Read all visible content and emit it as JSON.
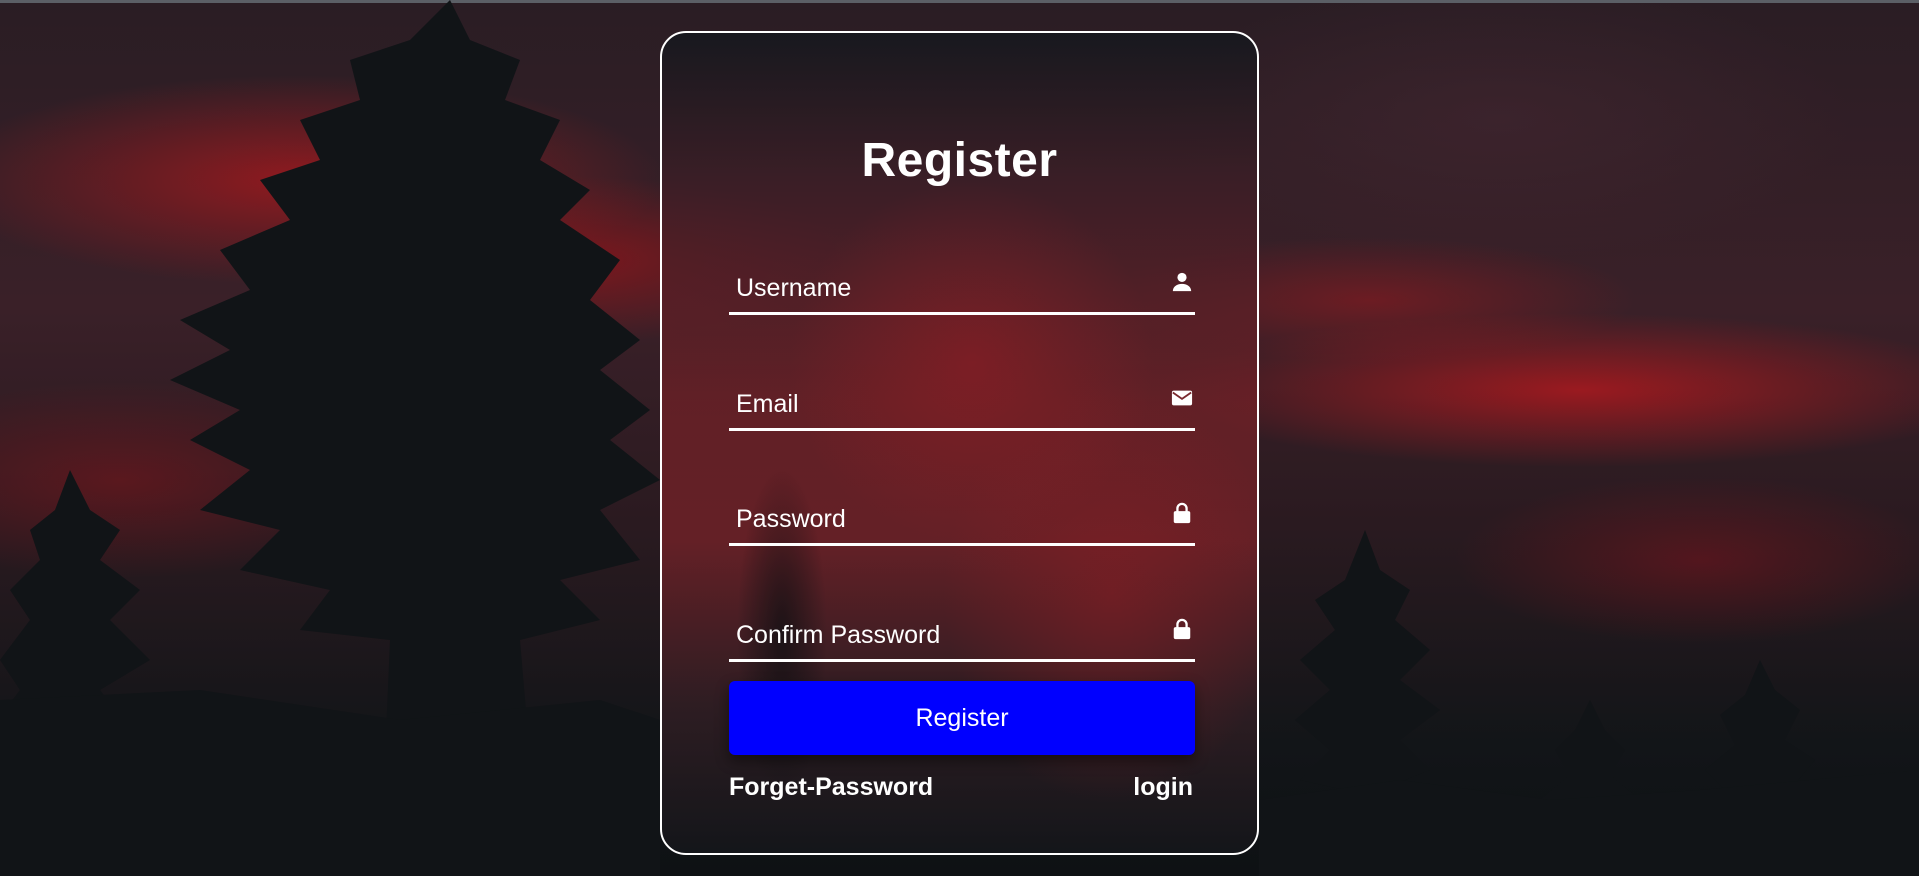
{
  "form": {
    "title": "Register",
    "fields": [
      {
        "placeholder": "Username",
        "icon": "user-icon"
      },
      {
        "placeholder": "Email",
        "icon": "mail-icon"
      },
      {
        "placeholder": "Password",
        "icon": "lock-icon"
      },
      {
        "placeholder": "Confirm Password",
        "icon": "lock-icon"
      }
    ],
    "submit_label": "Register",
    "forget_label": "Forget-Password",
    "login_label": "login"
  },
  "colors": {
    "button": "#0000ff",
    "text": "#ffffff",
    "border": "#ffffff"
  }
}
